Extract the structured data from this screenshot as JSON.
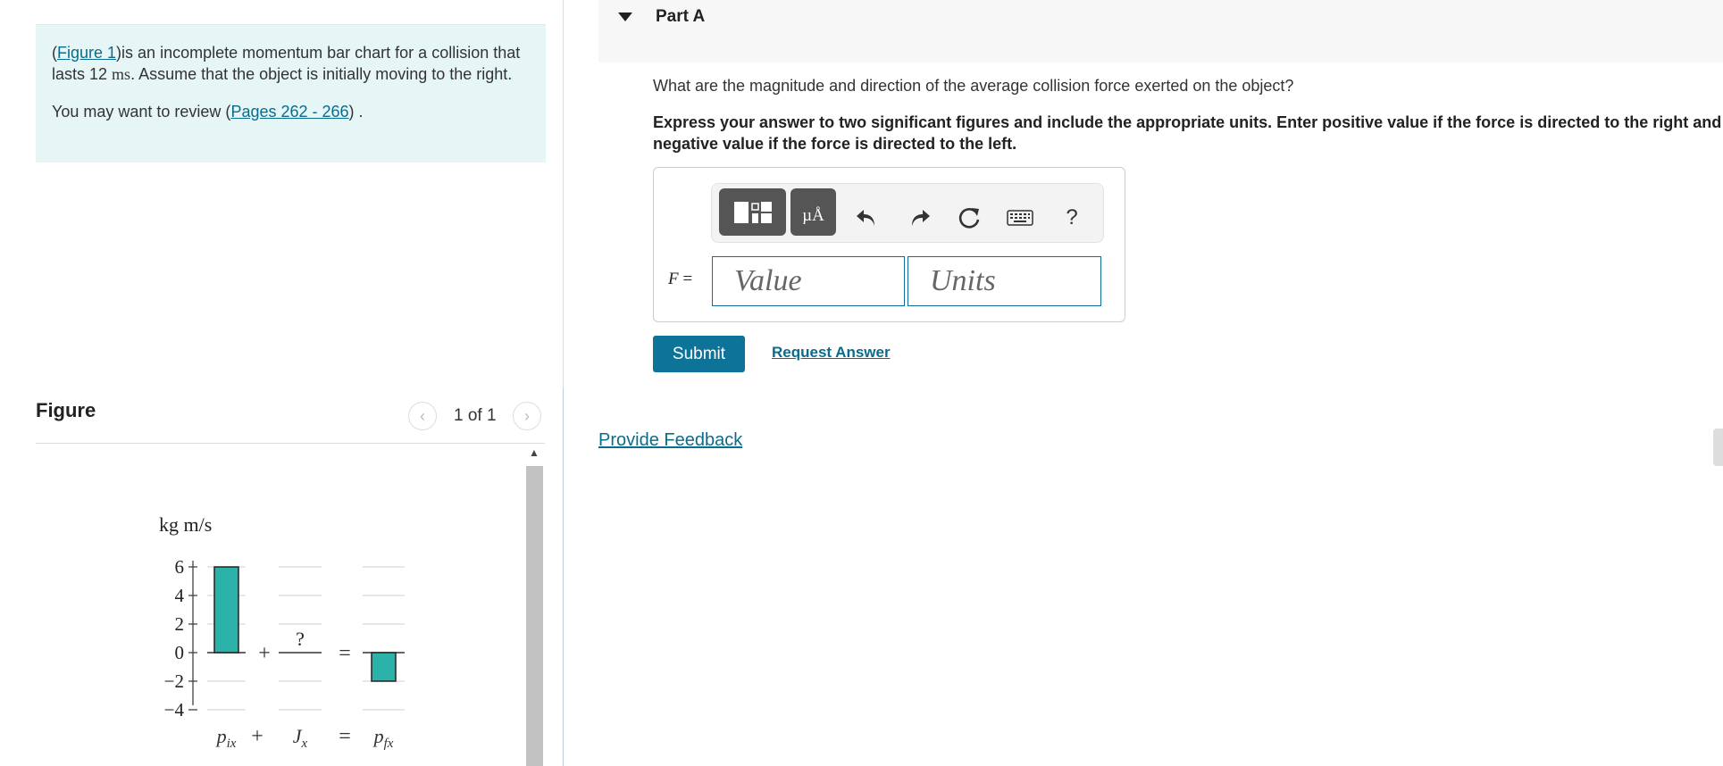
{
  "intro": {
    "open_paren": "(",
    "figure_link": "Figure 1",
    "text_a": ")is an incomplete momentum bar chart for a collision that lasts 12 ",
    "unit": "ms",
    "text_b": ". Assume that the object is initially moving to the right.",
    "review_prefix": "You may want to review (",
    "review_link": "Pages 262 - 266",
    "review_suffix": ") ."
  },
  "figure": {
    "heading": "Figure",
    "counter": "1 of 1",
    "prev_icon": "chevron-left-icon",
    "next_icon": "chevron-right-icon"
  },
  "chart_data": {
    "type": "bar",
    "ylabel": "kg m/s",
    "yticks": [
      6,
      4,
      2,
      0,
      -2,
      -4
    ],
    "ytick_labels": [
      "6",
      "4",
      "2",
      "0",
      "−2",
      "−4"
    ],
    "ylim": [
      -4,
      6
    ],
    "categories": [
      "p_ix",
      "J_x",
      "p_fx"
    ],
    "values": [
      6,
      null,
      -2
    ],
    "unknown_label": "?",
    "operators": [
      "+",
      "="
    ],
    "bar_color": "#2bb3aa"
  },
  "part": {
    "title": "Part A",
    "question": "What are the magnitude and direction of the average collision force exerted on the object?",
    "instructions": "Express your answer to two significant figures and include the appropriate units. Enter positive value if the force is directed to the right and negative value if the force is directed to the left.",
    "variable_symbol": "F",
    "variable_equals": " =",
    "value_placeholder": "Value",
    "units_placeholder": "Units",
    "units_tool_label": "µÅ",
    "help_label": "?",
    "submit": "Submit",
    "request_answer": "Request Answer"
  },
  "feedback": "Provide Feedback",
  "colors": {
    "accent": "#0d7398",
    "intro_bg": "#e6f5f5",
    "bar": "#2bb3aa",
    "link": "#0a6c8c"
  }
}
